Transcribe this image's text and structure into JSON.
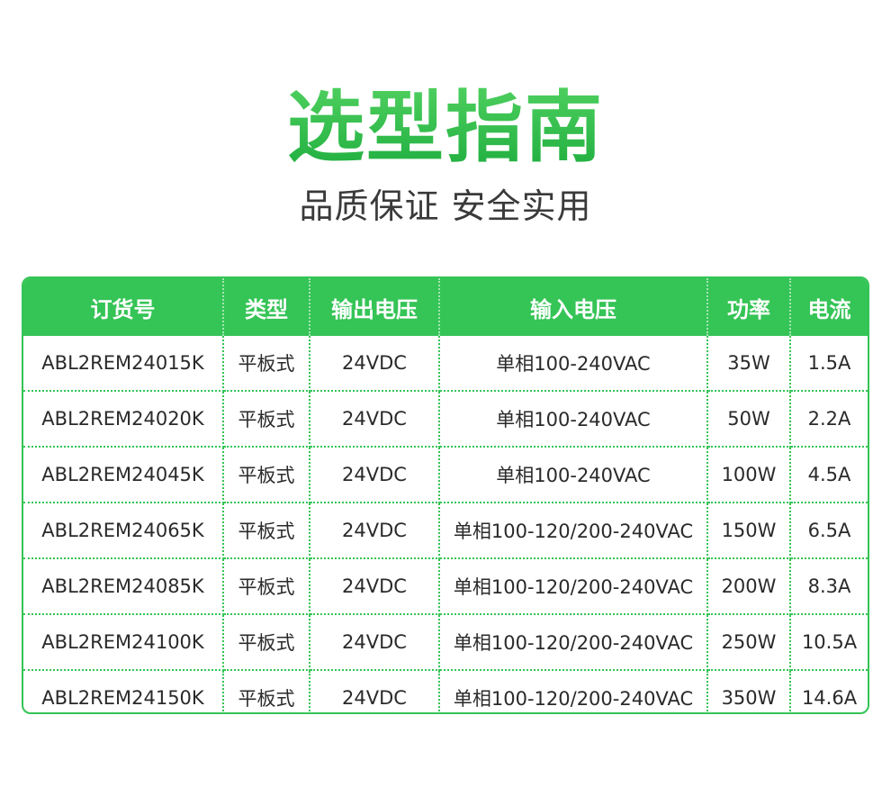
{
  "title": "选型指南",
  "subtitle": "品质保证 安全实用",
  "colors": {
    "accent_green": "#35c456",
    "title_green": "#2fb84d",
    "text_dark": "#2a2a2a"
  },
  "table": {
    "headers": [
      "订货号",
      "类型",
      "输出电压",
      "输入电压",
      "功率",
      "电流"
    ],
    "rows": [
      [
        "ABL2REM24015K",
        "平板式",
        "24VDC",
        "单相100-240VAC",
        "35W",
        "1.5A"
      ],
      [
        "ABL2REM24020K",
        "平板式",
        "24VDC",
        "单相100-240VAC",
        "50W",
        "2.2A"
      ],
      [
        "ABL2REM24045K",
        "平板式",
        "24VDC",
        "单相100-240VAC",
        "100W",
        "4.5A"
      ],
      [
        "ABL2REM24065K",
        "平板式",
        "24VDC",
        "单相100-120/200-240VAC",
        "150W",
        "6.5A"
      ],
      [
        "ABL2REM24085K",
        "平板式",
        "24VDC",
        "单相100-120/200-240VAC",
        "200W",
        "8.3A"
      ],
      [
        "ABL2REM24100K",
        "平板式",
        "24VDC",
        "单相100-120/200-240VAC",
        "250W",
        "10.5A"
      ],
      [
        "ABL2REM24150K",
        "平板式",
        "24VDC",
        "单相100-120/200-240VAC",
        "350W",
        "14.6A"
      ]
    ]
  }
}
